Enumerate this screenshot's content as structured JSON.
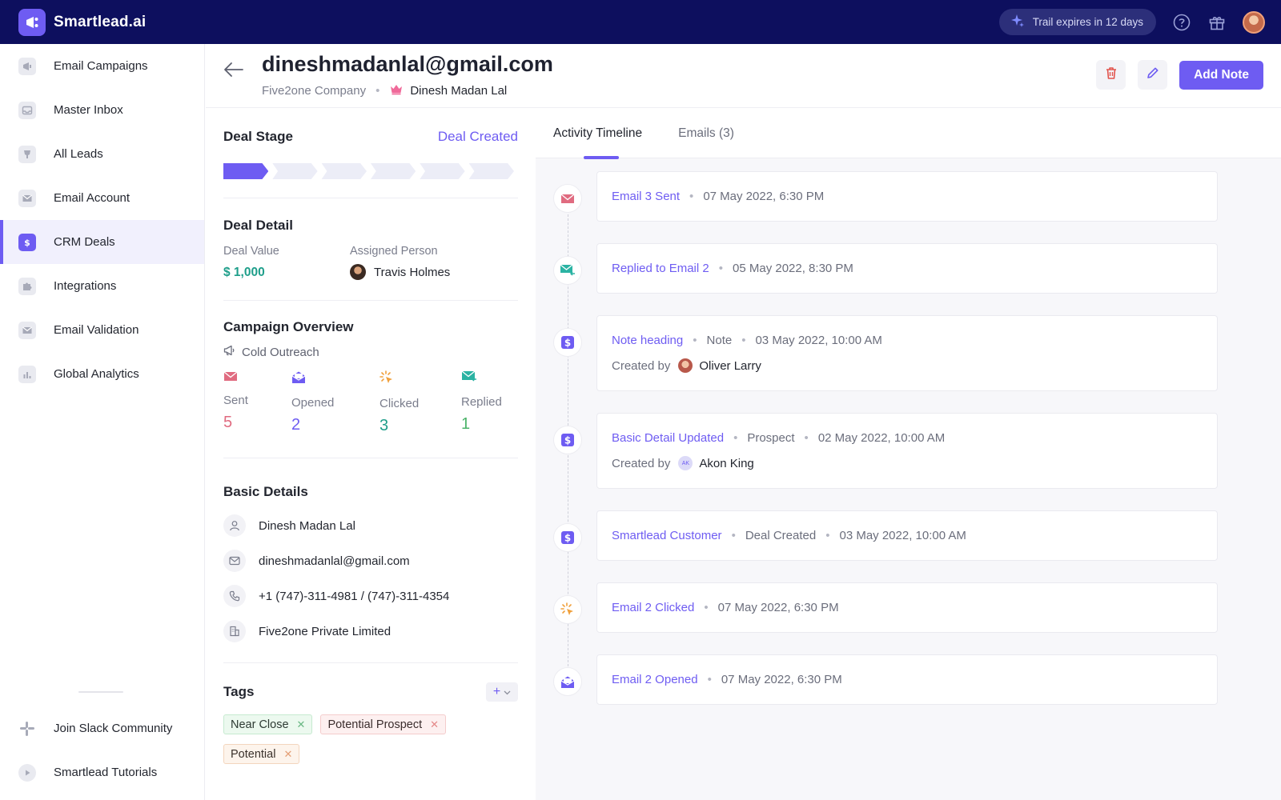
{
  "app": {
    "name": "Smartlead.ai"
  },
  "topbar": {
    "trial_text": "Trail expires in 12 days"
  },
  "sidebar": {
    "items": [
      {
        "label": "Email Campaigns",
        "icon": "megaphone-icon"
      },
      {
        "label": "Master Inbox",
        "icon": "inbox-icon"
      },
      {
        "label": "All Leads",
        "icon": "leads-icon"
      },
      {
        "label": "Email Account",
        "icon": "mail-icon"
      },
      {
        "label": "CRM Deals",
        "icon": "dollar-icon",
        "active": true
      },
      {
        "label": "Integrations",
        "icon": "puzzle-icon"
      },
      {
        "label": "Email Validation",
        "icon": "mail-check-icon"
      },
      {
        "label": "Global Analytics",
        "icon": "bar-chart-icon"
      }
    ],
    "bottom_items": [
      {
        "label": "Join Slack Community",
        "icon": "slack-icon"
      },
      {
        "label": "Smartlead Tutorials",
        "icon": "play-icon"
      }
    ]
  },
  "header": {
    "title": "dineshmadanlal@gmail.com",
    "company": "Five2one Company",
    "person": "Dinesh Madan Lal",
    "add_note_label": "Add Note"
  },
  "deal_stage": {
    "title": "Deal Stage",
    "status": "Deal Created",
    "stages_total": 6,
    "stages_done": 1
  },
  "deal_detail": {
    "title": "Deal Detail",
    "value_label": "Deal Value",
    "value": "$ 1,000",
    "assigned_label": "Assigned Person",
    "assigned_name": "Travis Holmes"
  },
  "campaign": {
    "title": "Campaign Overview",
    "name": "Cold Outreach",
    "stats": [
      {
        "label": "Sent",
        "value": "5",
        "color": "#e06b80"
      },
      {
        "label": "Opened",
        "value": "2",
        "color": "#6e5cf2"
      },
      {
        "label": "Clicked",
        "value": "3",
        "color": "#1e9e8a"
      },
      {
        "label": "Replied",
        "value": "1",
        "color": "#4cb36a"
      }
    ]
  },
  "basic_details": {
    "title": "Basic Details",
    "name": "Dinesh Madan Lal",
    "email": "dineshmadanlal@gmail.com",
    "phone": "+1 (747)-311-4981 / (747)-311-4354",
    "company": "Five2one Private Limited"
  },
  "tags": {
    "title": "Tags",
    "items": [
      {
        "label": "Near Close",
        "style": "green"
      },
      {
        "label": "Potential Prospect",
        "style": "pink"
      },
      {
        "label": "Potential",
        "style": "peach"
      }
    ]
  },
  "tabs": [
    {
      "label": "Activity Timeline",
      "active": true
    },
    {
      "label": "Emails (3)"
    }
  ],
  "timeline": [
    {
      "icon": "email-sent-icon",
      "title": "Email 3 Sent",
      "meta": [
        "07 May 2022, 6:30 PM"
      ]
    },
    {
      "icon": "email-replied-icon",
      "title": "Replied to Email 2",
      "meta": [
        "05 May 2022, 8:30 PM"
      ]
    },
    {
      "icon": "dollar-icon",
      "title": "Note heading",
      "meta": [
        "Note",
        "03 May 2022, 10:00 AM"
      ],
      "created_by_label": "Created by",
      "creator": "Oliver Larry",
      "creator_avatar": "photo"
    },
    {
      "icon": "dollar-icon",
      "title": "Basic Detail Updated",
      "meta": [
        "Prospect",
        "02 May 2022, 10:00 AM"
      ],
      "created_by_label": "Created by",
      "creator": "Akon King",
      "creator_initials": "AK"
    },
    {
      "icon": "dollar-icon",
      "title": "Smartlead Customer",
      "meta": [
        "Deal Created",
        "03 May 2022, 10:00 AM"
      ]
    },
    {
      "icon": "click-icon",
      "title": "Email 2 Clicked",
      "meta": [
        "07 May 2022, 6:30 PM"
      ]
    },
    {
      "icon": "email-opened-icon",
      "title": "Email 2 Opened",
      "meta": [
        "07 May 2022, 6:30 PM"
      ]
    }
  ]
}
